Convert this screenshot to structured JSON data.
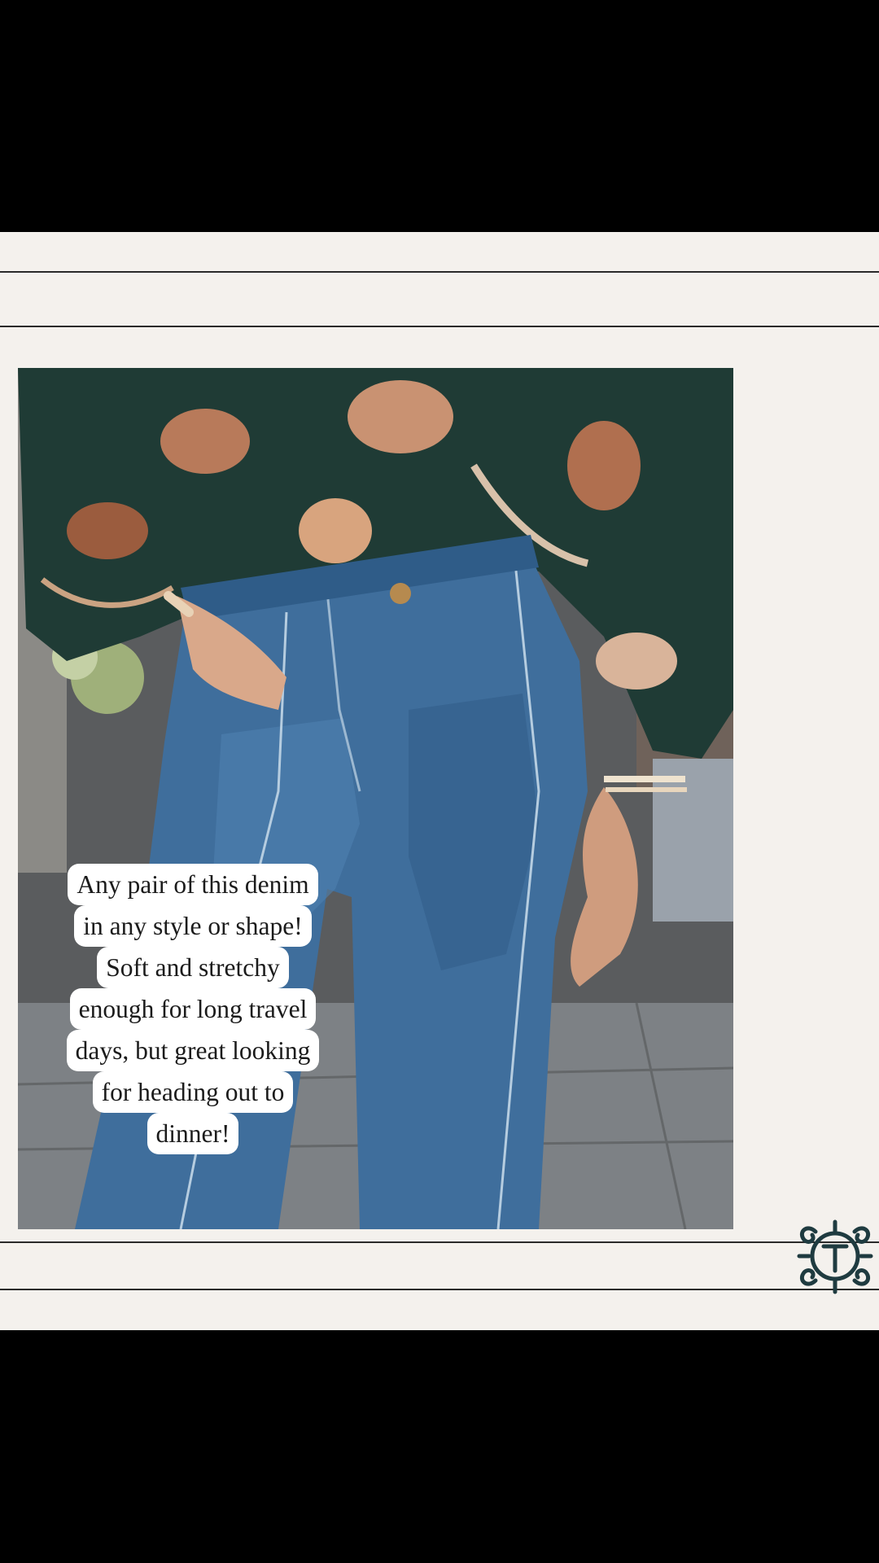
{
  "caption": {
    "lines": [
      "Any pair of this denim",
      "in any style or shape!",
      "Soft and stretchy",
      "enough for long travel",
      "days, but great looking",
      "for heading out to",
      "dinner!"
    ]
  },
  "photo": {
    "subject": "woman in floral green blouse and wide-leg blue jeans",
    "blouse_color": "#1f3b35",
    "denim_color": "#3f6e9c",
    "background_color": "#4b4e52"
  },
  "page": {
    "background": "#f4f1ed",
    "letterbox": "#000000",
    "rule_color": "#2a2a2a"
  },
  "logo": {
    "icon": "monogram-logo-icon",
    "color": "#1f3b40"
  }
}
